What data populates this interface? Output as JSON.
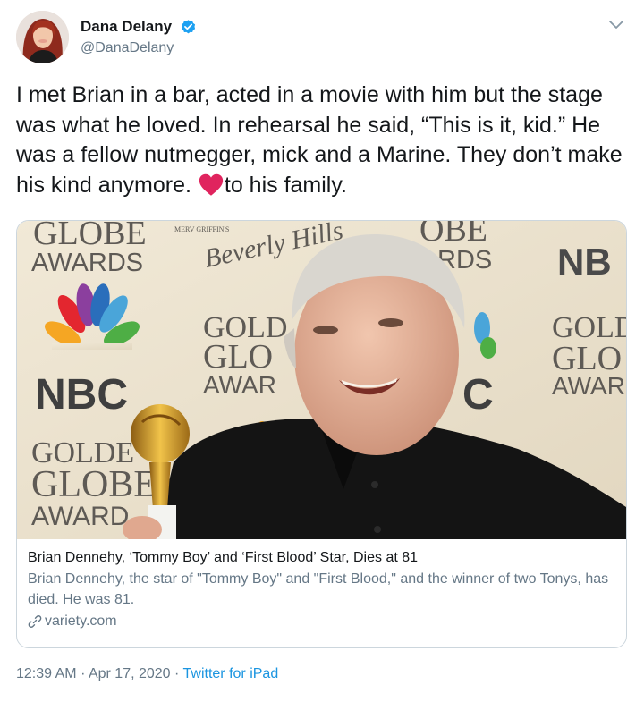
{
  "author": {
    "display_name": "Dana Delany",
    "handle": "@DanaDelany",
    "verified": true,
    "avatar_icon": "profile-photo",
    "menu_icon": "chevron-down-icon"
  },
  "tweet": {
    "text_before_heart": "I met Brian in a bar, acted in a movie with him but the stage was what he loved. In rehearsal he said, “This is it, kid.” He was a fellow nutmegger, mick and a Marine. They don’t make his kind anymore. ",
    "heart_emoji": "red-heart-icon",
    "text_after_heart": "to his family."
  },
  "card": {
    "image": {
      "backdrop_texts": [
        "GLOBE",
        "AWARDS",
        "MERV GRIFFIN'S",
        "Beverly Hills",
        "OBE",
        "RDS",
        "NB",
        "GOLD",
        "GLO",
        "AWAR",
        "GOLD",
        "GLO",
        "AWAR",
        "NBC",
        "GOLDE",
        "GLOBE",
        "AWARD",
        "C"
      ]
    },
    "title": "Brian Dennehy, ‘Tommy Boy’ and ‘First Blood’ Star, Dies at 81",
    "description": "Brian Dennehy, the star of \"Tommy Boy\" and \"First Blood,\" and the winner of two Tonys, has died. He was 81.",
    "domain": "variety.com",
    "domain_icon": "link-icon"
  },
  "footer": {
    "time": "12:39 AM",
    "separator": "·",
    "date": "Apr 17, 2020",
    "source": "Twitter for iPad"
  },
  "colors": {
    "text": "#14171a",
    "secondary": "#657786",
    "link": "#1b95e0",
    "verified": "#1da1f2",
    "heart": "#e0245e"
  }
}
